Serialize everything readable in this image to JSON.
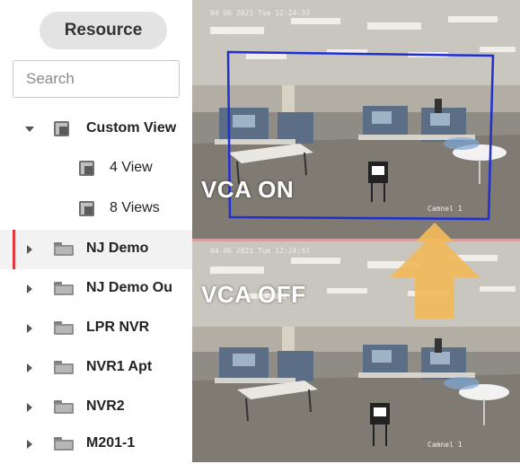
{
  "sidebar": {
    "resource_label": "Resource",
    "search_placeholder": "Search",
    "tree": [
      {
        "label": "Custom View",
        "type": "view-group",
        "expanded": true
      },
      {
        "label": "4 View",
        "type": "view"
      },
      {
        "label": "8 Views",
        "type": "view"
      },
      {
        "label": "NJ Demo",
        "type": "folder",
        "selected": true
      },
      {
        "label": "NJ Demo Ou",
        "type": "folder"
      },
      {
        "label": "LPR NVR",
        "type": "folder"
      },
      {
        "label": "NVR1 Apt",
        "type": "folder"
      },
      {
        "label": "NVR2",
        "type": "folder"
      },
      {
        "label": "M201-1",
        "type": "folder"
      }
    ]
  },
  "cameras": {
    "top": {
      "overlay": "VCA ON",
      "timestamp": "04 06 2021 Tue 12:24:33",
      "channel": "Camnel 1"
    },
    "bottom": {
      "overlay": "VCA OFF",
      "timestamp": "04 06 2021 Tue 12:24:33",
      "channel": "Camnel 1"
    }
  },
  "colors": {
    "selection_bar": "#e03a3e",
    "vca_box": "#1f2fd0",
    "arrow": "#f1b85a",
    "divider": "#d9a0a0"
  },
  "icons": {
    "expand": "caret-right-icon",
    "collapse": "caret-down-icon",
    "folder": "folder-icon",
    "view": "view-icon"
  }
}
